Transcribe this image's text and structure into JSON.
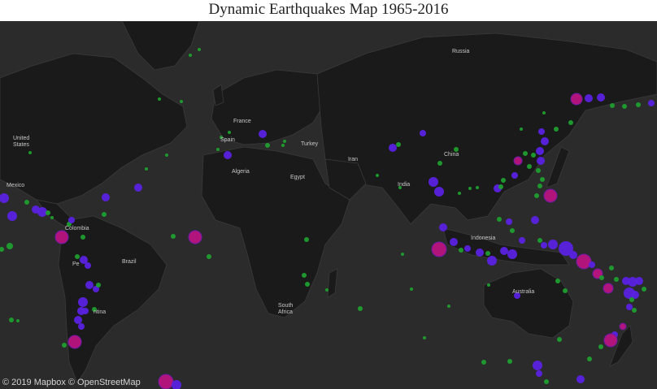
{
  "title": "Dynamic Earthquakes Map 1965-2016",
  "attribution": "© 2019 Mapbox © OpenStreetMap",
  "labels": {
    "russia": "Russia",
    "france": "France",
    "spain": "Spain",
    "turkey": "Turkey",
    "united_states": "United\nStates",
    "algeria": "Algeria",
    "egypt": "Egypt",
    "iran": "Iran",
    "china": "China",
    "india": "India",
    "mexico": "Mexico",
    "colombia": "Colombia",
    "peru": "Pe",
    "brazil": "Brazil",
    "argentina": "ntina",
    "indonesia": "Indonesia",
    "australia": "Australia",
    "south_africa": "South\nAfrica"
  },
  "colors": {
    "background": "#2b2b2b",
    "land": "#1a1a1a",
    "small_quake": "#1f9e2f",
    "medium_quake": "#5a22e0",
    "large_quake": "#b8137f"
  }
}
